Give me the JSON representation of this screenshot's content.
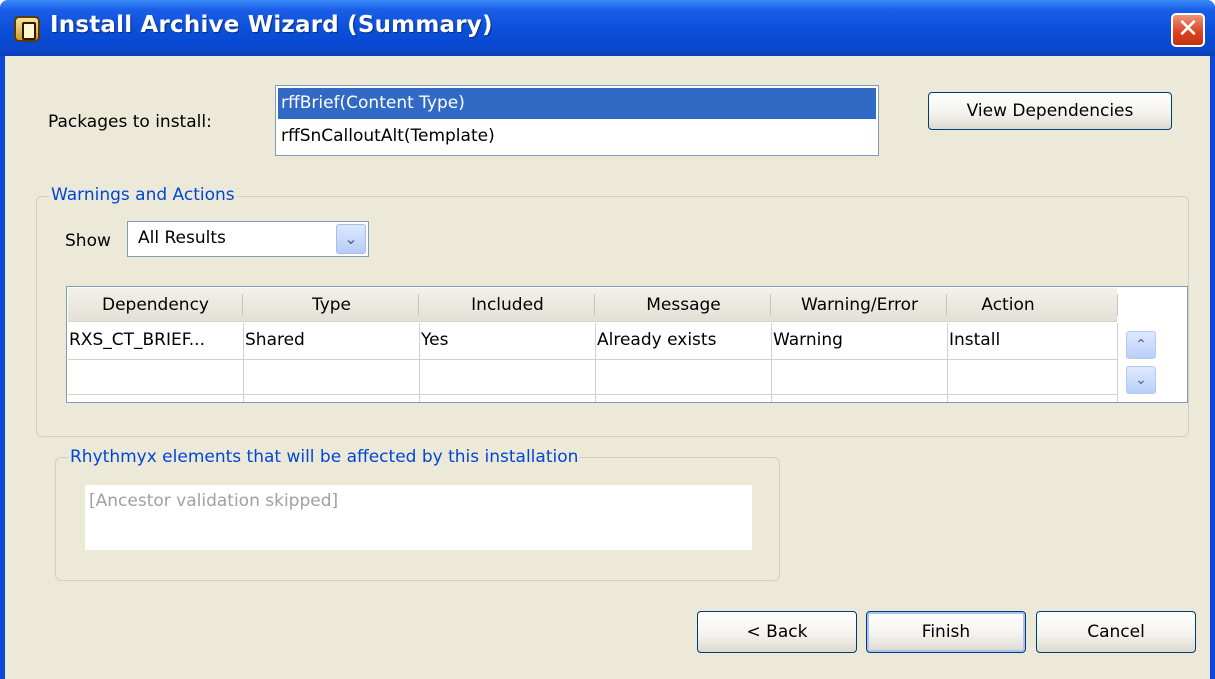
{
  "window": {
    "title": "Install Archive Wizard (Summary)",
    "close_glyph": "✕"
  },
  "packages": {
    "label": "Packages to install:",
    "items": [
      "rffBrief(Content Type)",
      "rffSnCalloutAlt(Template)"
    ],
    "selected_index": 0
  },
  "view_dependencies_label": "View Dependencies",
  "warnings": {
    "title": "Warnings and Actions",
    "show_label": "Show",
    "show_value": "All Results",
    "columns": [
      "Dependency",
      "Type",
      "Included",
      "Message",
      "Warning/Error",
      "Action"
    ],
    "rows": [
      [
        "RXS_CT_BRIEF...",
        "Shared",
        "Yes",
        "Already exists",
        "Warning",
        "Install"
      ]
    ]
  },
  "affected": {
    "title": "Rhythmyx elements that will be affected by this installation",
    "text": "[Ancestor validation skipped]"
  },
  "buttons": {
    "back": "< Back",
    "finish": "Finish",
    "cancel": "Cancel"
  },
  "colors": {
    "titlebar": "#0b4fd8",
    "selection": "#316ac5",
    "group_title": "#0046d5",
    "face": "#ece9d8"
  }
}
